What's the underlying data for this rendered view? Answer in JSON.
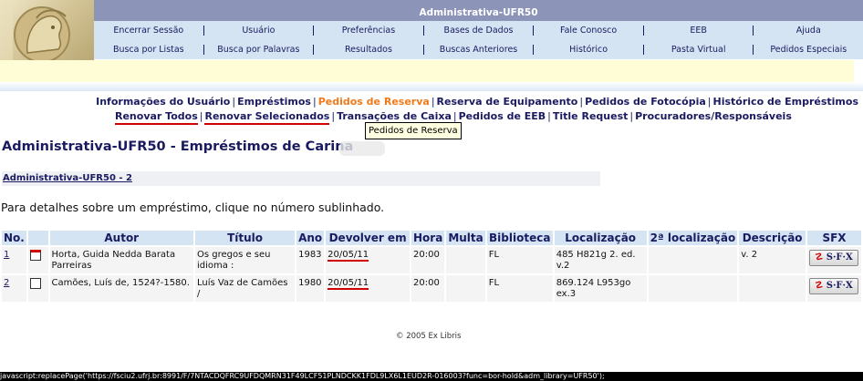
{
  "header": {
    "title": "Administrativa-UFR50",
    "nav1": [
      "Encerrar Sessão",
      "Usuário",
      "Preferências",
      "Bases de Dados",
      "Fale Conosco",
      "EEB",
      "Ajuda"
    ],
    "nav2": [
      "Busca por Listas",
      "Busca por Palavras",
      "Resultados",
      "Buscas Anteriores",
      "Histórico",
      "Pasta Virtual",
      "Pedidos Especiais"
    ]
  },
  "links1": [
    "Informações do Usuário",
    "Empréstimos",
    "Pedidos de Reserva",
    "Reserva de Equipamento",
    "Pedidos de Fotocópia",
    "Histórico de Empréstimos"
  ],
  "links2": [
    "Renovar Todos",
    "Renovar Selecionados",
    "Transações de Caixa",
    "Pedidos de EEB",
    "Title Request",
    "Procuradores/Responsáveis"
  ],
  "tooltip": "Pedidos de Reserva",
  "page": {
    "title": "Administrativa-UFR50 - Empréstimos de Carina",
    "sublink": "Administrativa-UFR50 - 2",
    "hint": "Para detalhes sobre um empréstimo, clique no número sublinhado."
  },
  "table": {
    "headers": [
      "No.",
      "",
      "Autor",
      "Título",
      "Ano",
      "Devolver em",
      "Hora",
      "Multa",
      "Biblioteca",
      "Localização",
      "2ª localização",
      "Descrição",
      "SFX"
    ],
    "rows": [
      {
        "no": "1",
        "autor": "Horta, Guida Nedda Barata Parreiras",
        "titulo": "Os gregos e seu idioma :",
        "ano": "1983",
        "devolver": "20/05/11",
        "hora": "20:00",
        "multa": "",
        "biblioteca": "FL",
        "localizacao": "485 H821g 2. ed. v.2",
        "loc2": "",
        "descricao": "v. 2",
        "sfx": "S·F·X"
      },
      {
        "no": "2",
        "autor": "Camões, Luís de, 1524?-1580.",
        "titulo": "Luís Vaz de Camões /",
        "ano": "1980",
        "devolver": "20/05/11",
        "hora": "20:00",
        "multa": "",
        "biblioteca": "FL",
        "localizacao": "869.124 L953go ex.3",
        "loc2": "",
        "descricao": "",
        "sfx": "S·F·X"
      }
    ]
  },
  "footer": "© 2005 Ex Libris",
  "status": "javascript:replacePage('https://fsciu2.ufrj.br:8991/F/7NTACDQFRC9UFDQMRN31F49LCF51PLNDCKK1FDL9LX6L1EUD2R-016003?func=bor-hold&adm_library=UFR50');",
  "colors": {
    "titlebar": "#8c94b8",
    "nav": "#d4e4f3",
    "link": "#1a1a60",
    "active": "#f07a1a",
    "underline": "#d00000"
  }
}
